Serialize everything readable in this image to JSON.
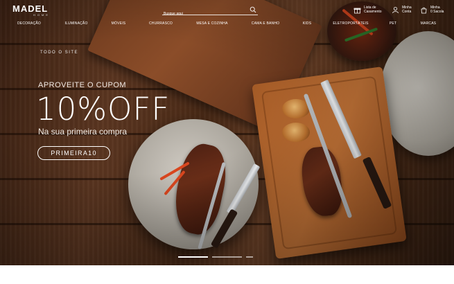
{
  "brand": {
    "name": "MADEL",
    "sub": "HOME"
  },
  "search": {
    "placeholder": "Busque aqui"
  },
  "header_links": [
    {
      "icon": "gift-icon",
      "line1": "Lista de",
      "line2": "Casamento"
    },
    {
      "icon": "user-icon",
      "line1": "Minha",
      "line2": "Conta"
    },
    {
      "icon": "bag-icon",
      "line1": "Minha",
      "line2": "Sacola",
      "badge": "0"
    }
  ],
  "nav": [
    "DECORAÇÃO",
    "ILUMINAÇÃO",
    "MÓVEIS",
    "CHURRASCO",
    "MESA E COZINHA",
    "CAMA E BANHO",
    "KIDS",
    "ELETROPORTÁTEIS",
    "PET",
    "MARCAS"
  ],
  "hero": {
    "crumb": "TODO O SITE",
    "pre": "APROVEITE O CUPOM",
    "big": "10%OFF",
    "sub": "Na sua primeira compra",
    "coupon": "PRIMEIRA10"
  },
  "slider": {
    "count": 3,
    "active": 0
  },
  "colors": {
    "text": "#ffffff",
    "wood": "#5a3520",
    "bottom": "#ffffff"
  }
}
